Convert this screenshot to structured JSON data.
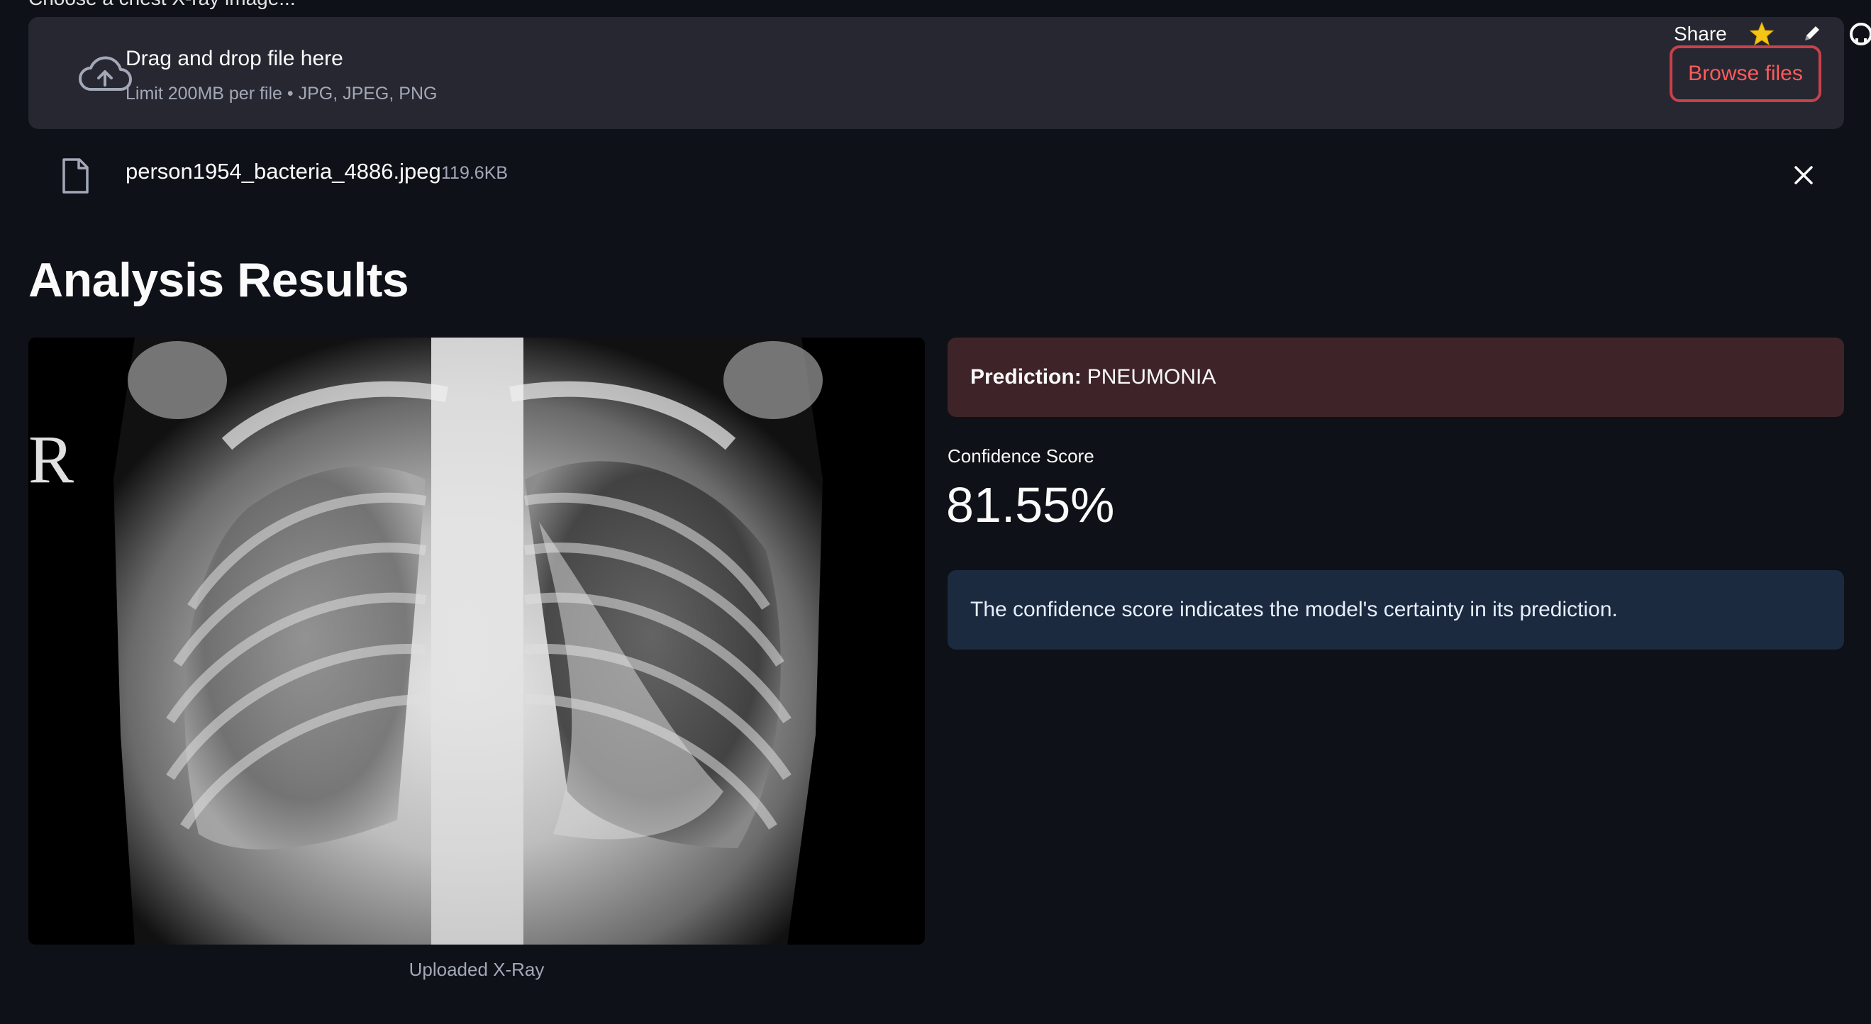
{
  "uploader": {
    "cut_label": "Choose a chest X-ray image...",
    "title": "Drag and drop file here",
    "subtitle": "Limit 200MB per file • JPG, JPEG, PNG",
    "browse_label": "Browse files",
    "icon": "cloud-upload-icon"
  },
  "toolbar": {
    "share_label": "Share",
    "icons": [
      "star-icon",
      "pencil-icon",
      "github-icon"
    ]
  },
  "file": {
    "name": "person1954_bacteria_4886.jpeg",
    "size": "119.6KB",
    "icon": "file-icon"
  },
  "section": {
    "title": "Analysis Results"
  },
  "image": {
    "caption": "Uploaded X-Ray",
    "marker": "R"
  },
  "prediction": {
    "label": "Prediction:",
    "value": "PNEUMONIA",
    "color": "#3e2428"
  },
  "metric": {
    "label": "Confidence Score",
    "value": "81.55%"
  },
  "info": {
    "text": "The confidence score indicates the model's certainty in its prediction.",
    "color": "#1b2a3e"
  },
  "colors": {
    "background": "#0e1117",
    "panel": "#262730",
    "accent": "#ff4b4b"
  }
}
